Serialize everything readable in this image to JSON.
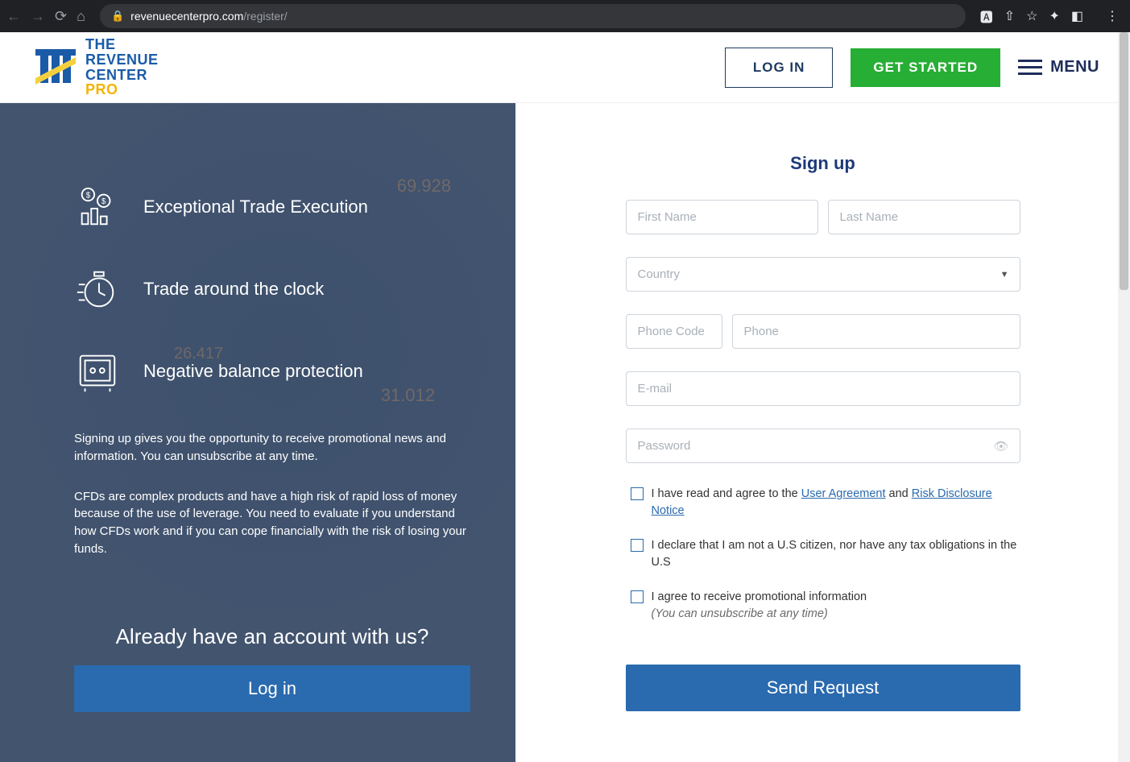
{
  "browser": {
    "url_host": "revenuecenterpro.com",
    "url_path": "/register/"
  },
  "logo": {
    "line1": "THE",
    "line2": "REVENUE",
    "line3": "CENTER",
    "line4": "PRO"
  },
  "header": {
    "login_label": "LOG IN",
    "get_started_label": "GET STARTED",
    "menu_label": "MENU"
  },
  "left": {
    "features": [
      {
        "title": "Exceptional Trade Execution"
      },
      {
        "title": "Trade around the clock"
      },
      {
        "title": "Negative balance protection"
      }
    ],
    "info1": "Signing up gives you the opportunity to receive promotional news and information. You can unsubscribe at any time.",
    "info2": "CFDs are complex products and have a high risk of rapid loss of money because of the use of leverage. You need to evaluate if you understand how CFDs work and if you can cope financially with the risk of losing your funds.",
    "already_title": "Already have an account with us?",
    "login_button": "Log in",
    "ghost_number": "26.417"
  },
  "form": {
    "title": "Sign up",
    "first_name_placeholder": "First Name",
    "last_name_placeholder": "Last Name",
    "country_placeholder": "Country",
    "phone_code_placeholder": "Phone Code",
    "phone_placeholder": "Phone",
    "email_placeholder": "E-mail",
    "password_placeholder": "Password",
    "agree1_prefix": "I have read and agree to the ",
    "agree1_link1": "User Agreement",
    "agree1_mid": " and ",
    "agree1_link2": "Risk Disclosure Notice",
    "agree2": "I declare that I am not a U.S citizen, nor have any tax obligations in the U.S",
    "agree3_line1": "I agree to receive promotional information",
    "agree3_line2": "(You can unsubscribe at any time)",
    "submit_label": "Send Request"
  }
}
